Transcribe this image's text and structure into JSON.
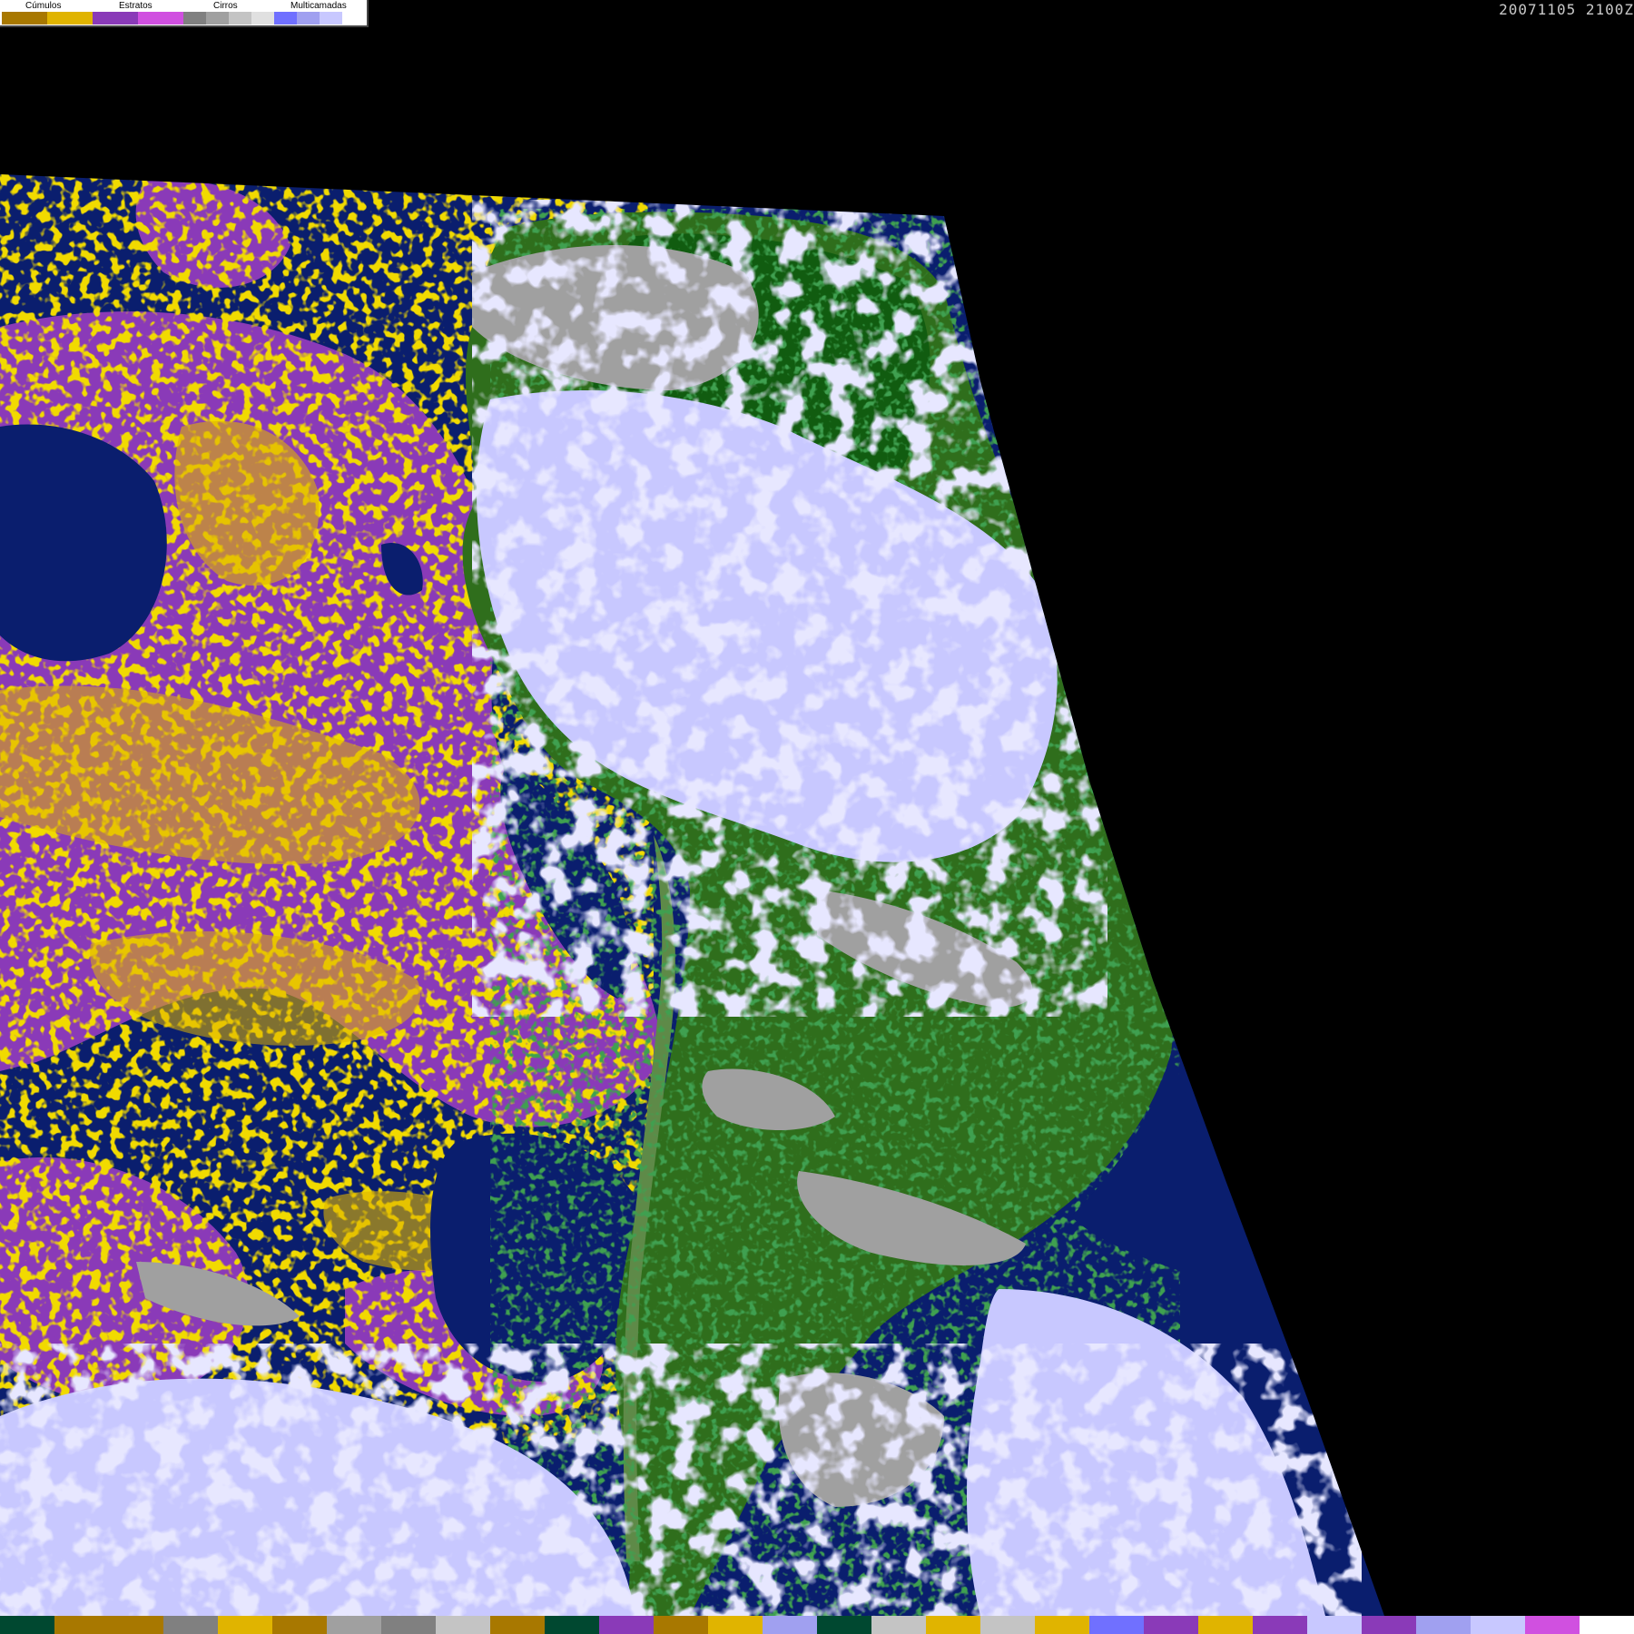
{
  "legend": {
    "groups": [
      {
        "label": "Cúmulos",
        "colors": [
          "#a87800",
          "#e0b400"
        ]
      },
      {
        "label": "Estratos",
        "colors": [
          "#8a3ab8",
          "#d050e0"
        ]
      },
      {
        "label": "Cirros",
        "colors": [
          "#808080",
          "#a0a0a0",
          "#c4c4c4",
          "#e0e0e0"
        ]
      },
      {
        "label": "Multicamadas",
        "colors": [
          "#7070ff",
          "#a0a0f0",
          "#c8c8ff",
          "#ffffff"
        ]
      }
    ]
  },
  "timestamp": "20071105 2100Z",
  "palette_strip": [
    "#004830",
    "#a87800",
    "#a87800",
    "#808080",
    "#e0b400",
    "#a87800",
    "#a0a0a0",
    "#808080",
    "#c4c4c4",
    "#a87800",
    "#004830",
    "#8a3ab8",
    "#a87800",
    "#e0b400",
    "#a0a0f0",
    "#004830",
    "#c4c4c4",
    "#e0b400",
    "#c4c4c4",
    "#e0b400",
    "#7070ff",
    "#8a3ab8",
    "#e0b400",
    "#8a3ab8",
    "#c8c8ff",
    "#8a3ab8",
    "#a0a0f0",
    "#c8c8ff",
    "#d050e0",
    "#ffffff"
  ],
  "colors": {
    "background": "#000000",
    "ocean": "#0a1e6e",
    "land": "#2f6e1c",
    "forest": "#0e5a10",
    "cumulus": "#e0b400",
    "stratus": "#8a3ab8",
    "cirrus": "#a0a0a0",
    "multilayer": "#c8c8ff"
  }
}
